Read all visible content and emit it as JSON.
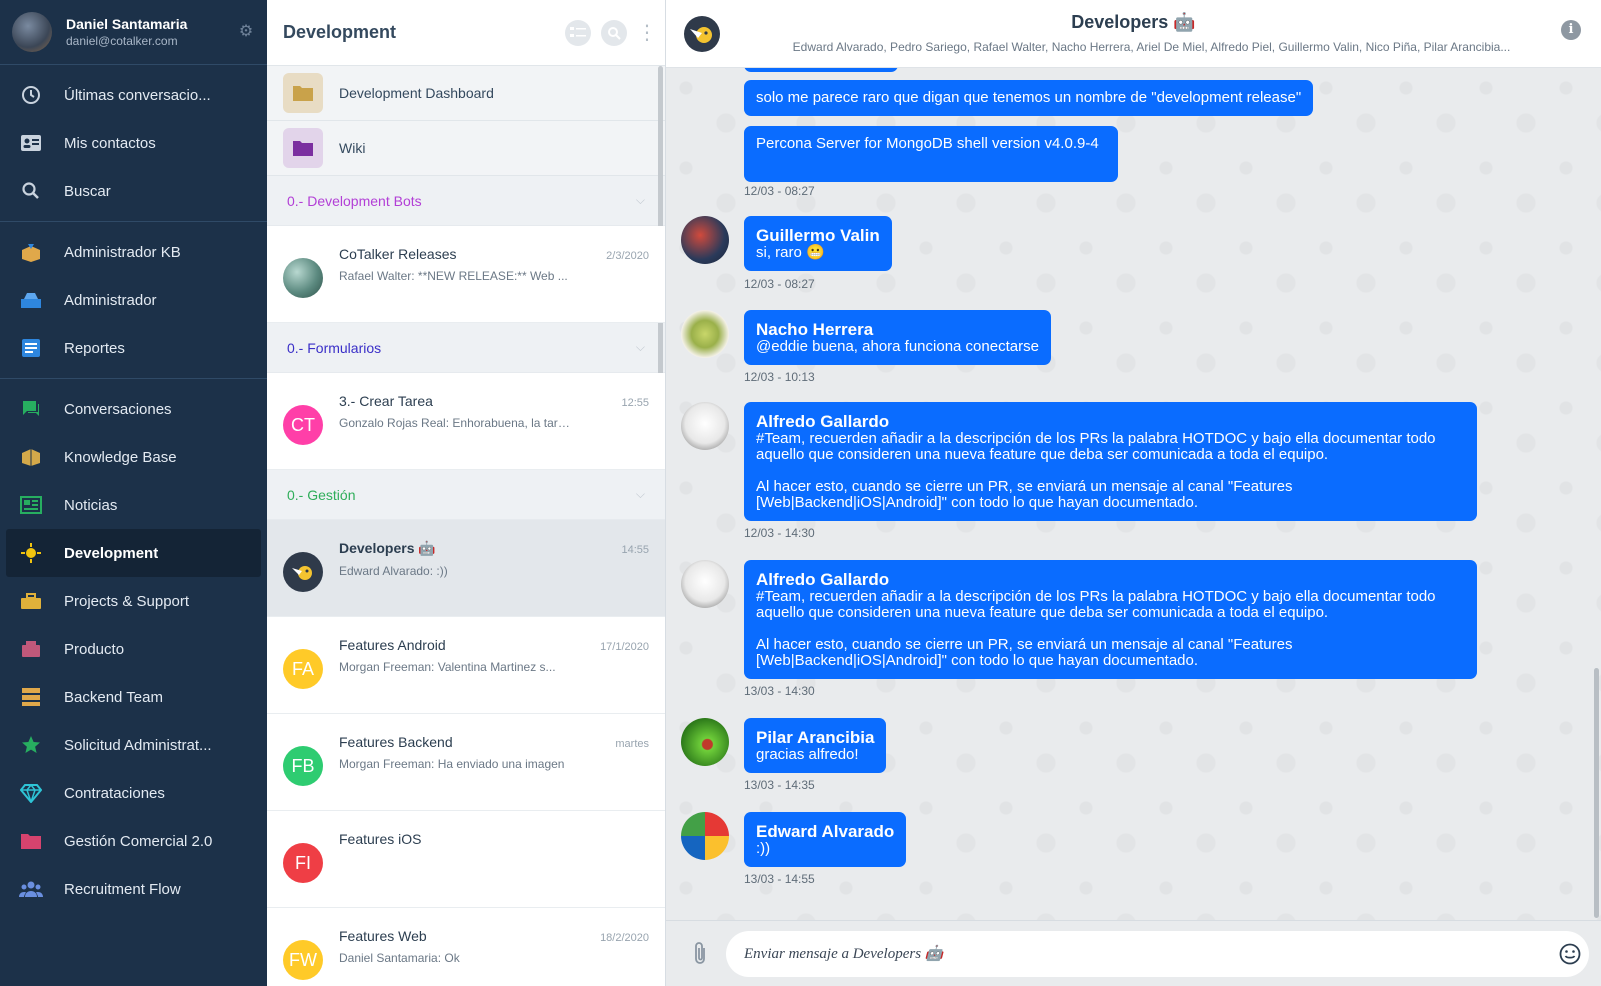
{
  "profile": {
    "name": "Daniel Santamaria",
    "email": "daniel@cotalker.com"
  },
  "nav": {
    "group1": [
      {
        "label": "Últimas conversacio...",
        "icon": "clock-icon"
      },
      {
        "label": "Mis contactos",
        "icon": "contact-card-icon"
      },
      {
        "label": "Buscar",
        "icon": "search-icon"
      }
    ],
    "group2": [
      {
        "label": "Administrador KB",
        "icon": "kb-admin-icon",
        "color": "#e0a84a"
      },
      {
        "label": "Administrador",
        "icon": "admin-icon",
        "color": "#2e86de"
      },
      {
        "label": "Reportes",
        "icon": "reports-icon",
        "color": "#2e86de"
      }
    ],
    "group3": [
      {
        "label": "Conversaciones",
        "icon": "chat-icon",
        "color": "#27ae60"
      },
      {
        "label": "Knowledge Base",
        "icon": "knowledge-icon",
        "color": "#d4a94a"
      },
      {
        "label": "Noticias",
        "icon": "news-icon",
        "color": "#27ae60"
      },
      {
        "label": "Development",
        "icon": "development-icon",
        "color": "#f1c40f"
      },
      {
        "label": "Projects & Support",
        "icon": "projects-icon",
        "color": "#e0b13a"
      },
      {
        "label": "Producto",
        "icon": "product-icon",
        "color": "#c0587a"
      },
      {
        "label": "Backend Team",
        "icon": "backend-icon",
        "color": "#e0a84a"
      },
      {
        "label": "Solicitud Administrat...",
        "icon": "star-icon",
        "color": "#27ae60"
      },
      {
        "label": "Contrataciones",
        "icon": "diamond-icon",
        "color": "#2ec4d6"
      },
      {
        "label": "Gestión Comercial 2.0",
        "icon": "folder-icon",
        "color": "#d6436e"
      },
      {
        "label": "Recruitment Flow",
        "icon": "people-icon",
        "color": "#6a8fe0"
      }
    ]
  },
  "list": {
    "title": "Development",
    "folders": [
      {
        "label": "Development Dashboard",
        "color": "#c9a24a",
        "bg": "#e8dcc4"
      },
      {
        "label": "Wiki",
        "color": "#7b2fa0",
        "bg": "#e2d4ea"
      }
    ],
    "sections": [
      {
        "title": "0.- Development Bots",
        "color": "#b23fd6"
      },
      {
        "title": "0.- Formularios",
        "color": "#3a2fc8"
      },
      {
        "title": "0.- Gestión",
        "color": "#2fae5a"
      }
    ],
    "conversations": [
      {
        "title": "CoTalker Releases",
        "time": "2/3/2020",
        "preview": "Rafael Walter: **NEW RELEASE:** Web ...",
        "initials": ""
      },
      {
        "title": "3.- Crear Tarea",
        "time": "12:55",
        "preview": "Gonzalo Rojas Real: Enhorabuena, la tarea ...",
        "initials": "CT"
      },
      {
        "title": "Developers 🤖",
        "time": "14:55",
        "preview": "Edward Alvarado: :))",
        "initials": ""
      },
      {
        "title": "Features Android",
        "time": "17/1/2020",
        "preview": "Morgan Freeman: Valentina Martinez s...",
        "initials": "FA"
      },
      {
        "title": "Features Backend",
        "time": "martes",
        "preview": "Morgan Freeman: Ha enviado una imagen",
        "initials": "FB"
      },
      {
        "title": "Features iOS",
        "time": "",
        "preview": "",
        "initials": "FI"
      },
      {
        "title": "Features Web",
        "time": "18/2/2020",
        "preview": "Daniel Santamaria: Ok",
        "initials": "FW"
      }
    ]
  },
  "chat": {
    "title": "Developers 🤖",
    "members": "Edward Alvarado, Pedro Sariego, Rafael Walter, Nacho Herrera, Ariel De Miel, Alfredo Piel, Guillermo Valin, Nico Piña, Pilar Arancibia...",
    "messages": [
      {
        "sender": "",
        "text": "solo me parece raro que digan que tenemos un nombre de \"development release\"",
        "stamp": ""
      },
      {
        "sender": "",
        "text": "Percona Server for MongoDB shell version v4.0.9-4",
        "stamp": "12/03 - 08:27"
      },
      {
        "sender": "Guillermo Valin",
        "text": "si, raro 😬",
        "stamp": "12/03 - 08:27"
      },
      {
        "sender": "Nacho Herrera",
        "text": "@eddie buena, ahora funciona conectarse",
        "stamp": "12/03 - 10:13"
      },
      {
        "sender": "Alfredo Gallardo",
        "text": "#Team, recuerden añadir a la descripción de los PRs la palabra HOTDOC y bajo ella documentar todo aquello que consideren una nueva feature que deba ser comunicada a toda el equipo.",
        "text2": "Al hacer esto, cuando se cierre un PR, se enviará un mensaje al canal \"Features [Web|Backend|iOS|Android]\" con todo lo que hayan documentado.",
        "stamp": "12/03 - 14:30"
      },
      {
        "sender": "Alfredo Gallardo",
        "text": "#Team, recuerden añadir a la descripción de los PRs la palabra HOTDOC y bajo ella documentar todo aquello que consideren una nueva feature que deba ser comunicada a toda el equipo.",
        "text2": "Al hacer esto, cuando se cierre un PR, se enviará un mensaje al canal \"Features [Web|Backend|iOS|Android]\" con todo lo que hayan documentado.",
        "stamp": "13/03 - 14:30"
      },
      {
        "sender": "Pilar Arancibia",
        "text": "gracias alfredo!",
        "stamp": "13/03 - 14:35"
      },
      {
        "sender": "Edward Alvarado",
        "text": ":))",
        "stamp": "13/03 - 14:55"
      }
    ],
    "composer_placeholder": "Enviar mensaje a Developers 🤖"
  },
  "colors": {
    "sidebar": "#1c3149",
    "bubble": "#0a6cff"
  }
}
